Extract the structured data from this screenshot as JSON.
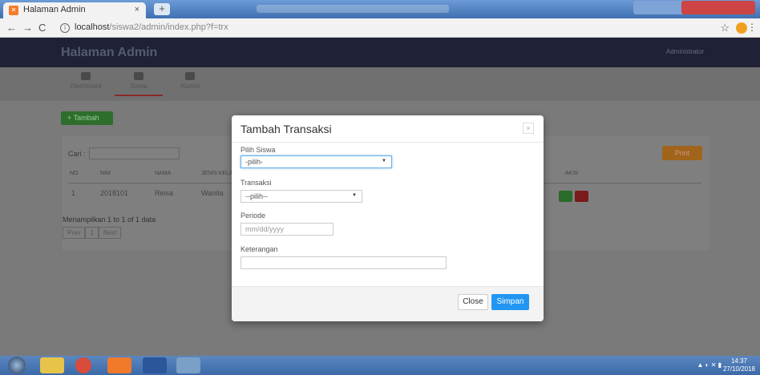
{
  "browser": {
    "tab_title": "Halaman Admin",
    "tab_close": "×",
    "new_tab": "+",
    "url_host": "localhost",
    "url_path": "/siswa2/admin/index.php?f=trx",
    "back": "←",
    "forward": "→",
    "reload": "C",
    "star": "☆",
    "menu": "⋮"
  },
  "app": {
    "brand": "Halaman Admin",
    "user": "Administrator",
    "nav_tabs": [
      "Dashboard",
      "Siswa",
      "Alumni"
    ],
    "add_button": "+ Tambah",
    "search_label": "Cari :",
    "print_button": "Print",
    "table": {
      "headers": [
        "NO",
        "NIM",
        "NAMA",
        "JENIS KELAM",
        "AKSI"
      ],
      "rows": [
        [
          "1",
          "2018101",
          "Reisa",
          "Wanita"
        ]
      ]
    },
    "info": "Menampilkan 1 to 1 of 1 data",
    "pager": [
      "Prev",
      "1",
      "Next"
    ]
  },
  "modal": {
    "title": "Tambah Transaksi",
    "close_x": "×",
    "siswa_label": "Pilih Siswa",
    "siswa_value": "-pilih-",
    "transaksi_label": "Transaksi",
    "transaksi_value": "--pilih--",
    "periode_label": "Periode",
    "periode_placeholder": "mm/dd/yyyy",
    "keterangan_label": "Keterangan",
    "keterangan_value": "",
    "close_button": "Close",
    "save_button": "Simpan"
  },
  "taskbar": {
    "time": "14:37",
    "date": "27/10/2018"
  }
}
